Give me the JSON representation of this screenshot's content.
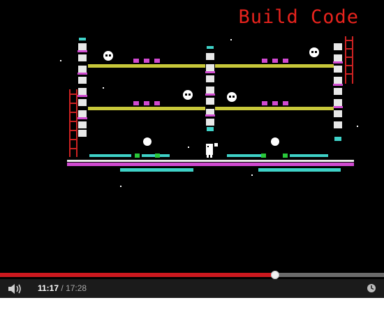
{
  "video": {
    "overlay_title": "Build Code"
  },
  "player": {
    "progress_fraction": 0.716,
    "time_current": "11:17",
    "time_separator": "/",
    "time_total": "17:28"
  },
  "icons": {
    "volume": "volume-icon",
    "clock": "clock-icon"
  },
  "colors": {
    "accent": "#cc181e",
    "overlay_title": "#e8231d",
    "platform": "#c8c83a",
    "floor": "#d04ad0",
    "cyan": "#3fd2c8"
  }
}
